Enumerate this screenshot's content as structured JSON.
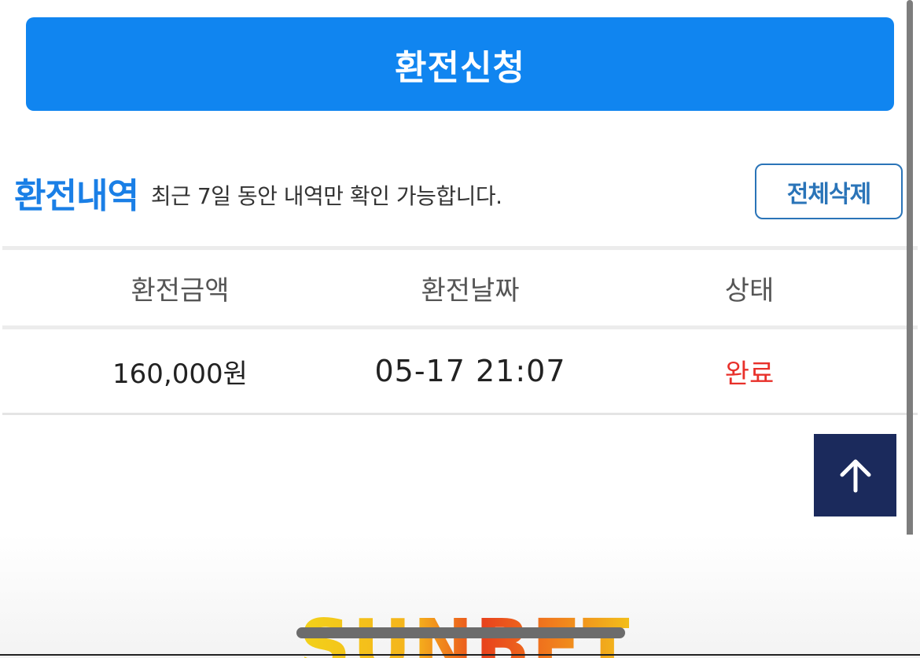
{
  "submit_button": {
    "label": "환전신청",
    "color": "#1085f0"
  },
  "history": {
    "title": "환전내역",
    "note": "최근 7일 동안 내역만 확인 가능합니다.",
    "delete_all_label": "전체삭제"
  },
  "table": {
    "columns": [
      "환전금액",
      "환전날짜",
      "상태"
    ],
    "rows": [
      {
        "amount": "160,000원",
        "date": "05-17 21:07",
        "status": "완료"
      }
    ]
  },
  "scroll_top": {
    "icon": "arrow-up-icon",
    "color": "#1b2a5c"
  },
  "logo": {
    "text": "SUNBET"
  },
  "colors": {
    "accent": "#1a7fe6",
    "status_done": "#e8302a"
  }
}
